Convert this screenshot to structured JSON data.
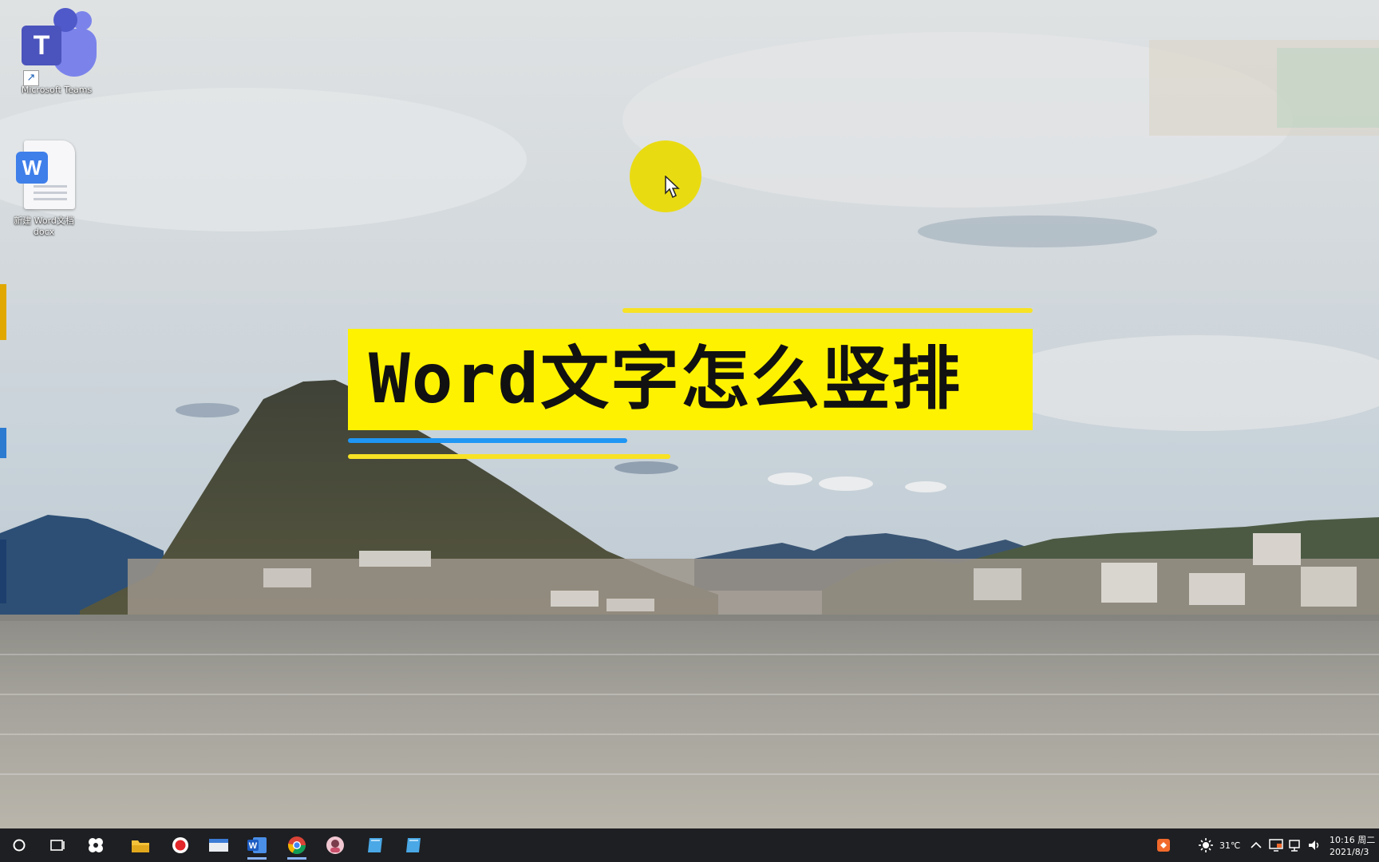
{
  "desktop": {
    "icons": [
      {
        "id": "teams",
        "label": "Microsoft Teams",
        "icon": "teams-icon"
      },
      {
        "id": "doc",
        "label_line1": "新建 Word文档",
        "label_line2": "docx",
        "icon": "word-document-icon"
      }
    ]
  },
  "overlay": {
    "title": "Word文字怎么竖排",
    "colors": {
      "box": "#fff200",
      "line_yellow": "#f7e224",
      "line_blue": "#1f96f3"
    }
  },
  "taskbar": {
    "apps": [
      {
        "name": "start",
        "icon": "start-circle-icon"
      },
      {
        "name": "task-view",
        "icon": "task-view-icon"
      },
      {
        "name": "app-s",
        "icon": "app-s-icon"
      },
      {
        "name": "file-explorer",
        "icon": "folder-icon"
      },
      {
        "name": "recorder",
        "icon": "record-icon"
      },
      {
        "name": "mail",
        "icon": "mail-icon"
      },
      {
        "name": "word",
        "icon": "word-icon"
      },
      {
        "name": "chrome",
        "icon": "chrome-icon"
      },
      {
        "name": "app-avatar",
        "icon": "avatar-icon"
      },
      {
        "name": "app-blue-1",
        "icon": "notes-icon"
      },
      {
        "name": "app-blue-2",
        "icon": "notes-icon"
      }
    ],
    "tray": {
      "temperature": "31℃",
      "time": "10:16 周二",
      "date": "2021/8/3"
    }
  }
}
